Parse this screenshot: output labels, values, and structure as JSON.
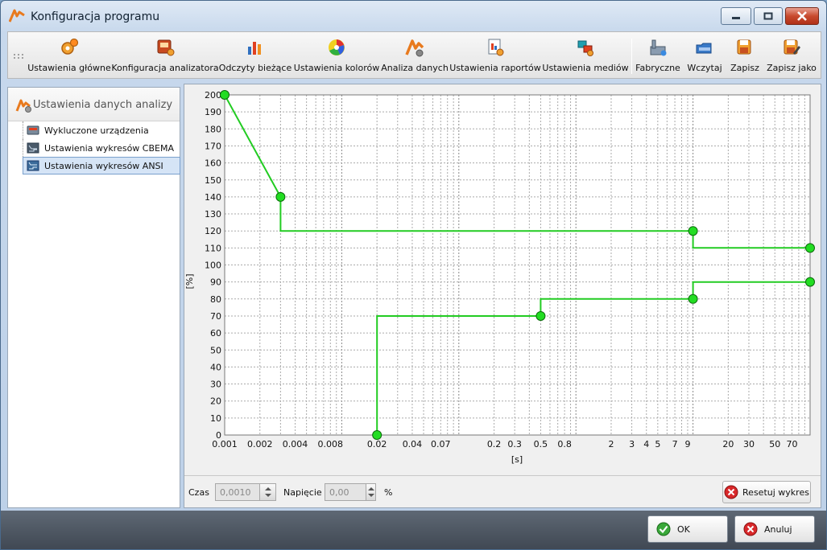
{
  "window": {
    "title": "Konfiguracja programu"
  },
  "toolbar": {
    "items": [
      {
        "label": "Ustawienia główne",
        "icon": "gears-icon"
      },
      {
        "label": "Konfiguracja analizatora",
        "icon": "analyzer-config-icon"
      },
      {
        "label": "Odczyty bieżące",
        "icon": "bar-readings-icon"
      },
      {
        "label": "Ustawienia kolorów",
        "icon": "color-wheel-icon"
      },
      {
        "label": "Analiza danych",
        "icon": "data-analysis-icon"
      },
      {
        "label": "Ustawienia raportów",
        "icon": "report-settings-icon"
      },
      {
        "label": "Ustawienia mediów",
        "icon": "media-settings-icon"
      },
      {
        "label": "Fabryczne",
        "icon": "factory-icon"
      },
      {
        "label": "Wczytaj",
        "icon": "load-icon"
      },
      {
        "label": "Zapisz",
        "icon": "save-icon"
      },
      {
        "label": "Zapisz jako",
        "icon": "save-as-icon"
      }
    ]
  },
  "sidebar": {
    "title": "Ustawienia danych analizy",
    "items": [
      {
        "label": "Wykluczone urządzenia",
        "selected": false
      },
      {
        "label": "Ustawienia wykresów CBEMA",
        "selected": false
      },
      {
        "label": "Ustawienia wykresów ANSI",
        "selected": true
      }
    ]
  },
  "chart_data": {
    "type": "line",
    "title": "",
    "xlabel": "[s]",
    "ylabel": "[%]",
    "xscale": "log",
    "xlim": [
      0.001,
      100
    ],
    "ylim": [
      0,
      200
    ],
    "yticks": [
      0,
      10,
      20,
      30,
      40,
      50,
      60,
      70,
      80,
      90,
      100,
      110,
      120,
      130,
      140,
      150,
      160,
      170,
      180,
      190,
      200
    ],
    "xticks": [
      {
        "v": 0.001,
        "label": "0.001"
      },
      {
        "v": 0.002,
        "label": "0.002"
      },
      {
        "v": 0.004,
        "label": "0.004"
      },
      {
        "v": 0.008,
        "label": "0.008"
      },
      {
        "v": 0.02,
        "label": "0.02"
      },
      {
        "v": 0.04,
        "label": "0.04"
      },
      {
        "v": 0.07,
        "label": "0.07"
      },
      {
        "v": 0.2,
        "label": "0.2"
      },
      {
        "v": 0.3,
        "label": "0.3"
      },
      {
        "v": 0.5,
        "label": "0.5"
      },
      {
        "v": 0.8,
        "label": "0.8"
      },
      {
        "v": 2,
        "label": "2"
      },
      {
        "v": 3,
        "label": "3"
      },
      {
        "v": 4,
        "label": "4"
      },
      {
        "v": 5,
        "label": "5"
      },
      {
        "v": 7,
        "label": "7"
      },
      {
        "v": 9,
        "label": "9"
      },
      {
        "v": 20,
        "label": "20"
      },
      {
        "v": 30,
        "label": "30"
      },
      {
        "v": 50,
        "label": "50"
      },
      {
        "v": 70,
        "label": "70"
      }
    ],
    "grid": true,
    "line_color": "#22cc22",
    "marker_color": "#22dd22",
    "series": [
      {
        "points": [
          [
            0.001,
            200
          ],
          [
            0.003,
            140
          ],
          [
            0.003,
            120
          ],
          [
            10,
            120
          ],
          [
            10,
            110
          ],
          [
            100,
            110
          ]
        ],
        "markers": [
          [
            0.001,
            200
          ],
          [
            0.003,
            140
          ],
          [
            10,
            120
          ],
          [
            100,
            110
          ]
        ]
      },
      {
        "points": [
          [
            0.02,
            0
          ],
          [
            0.02,
            70
          ],
          [
            0.5,
            70
          ],
          [
            0.5,
            80
          ],
          [
            10,
            80
          ],
          [
            10,
            90
          ],
          [
            100,
            90
          ]
        ],
        "markers": [
          [
            0.02,
            0
          ],
          [
            0.5,
            70
          ],
          [
            10,
            80
          ],
          [
            100,
            90
          ]
        ]
      }
    ]
  },
  "controls": {
    "time_label": "Czas",
    "time_value": "0,0010",
    "voltage_label": "Napięcie",
    "voltage_value": "0,00",
    "voltage_unit": "%",
    "reset_label": "Resetuj wykres"
  },
  "footer": {
    "ok_label": "OK",
    "cancel_label": "Anuluj"
  },
  "colors": {
    "accent": "#e87a1e",
    "close_red": "#c84a2e",
    "ok_green": "#3aa83a",
    "cancel_red": "#d8282a"
  }
}
